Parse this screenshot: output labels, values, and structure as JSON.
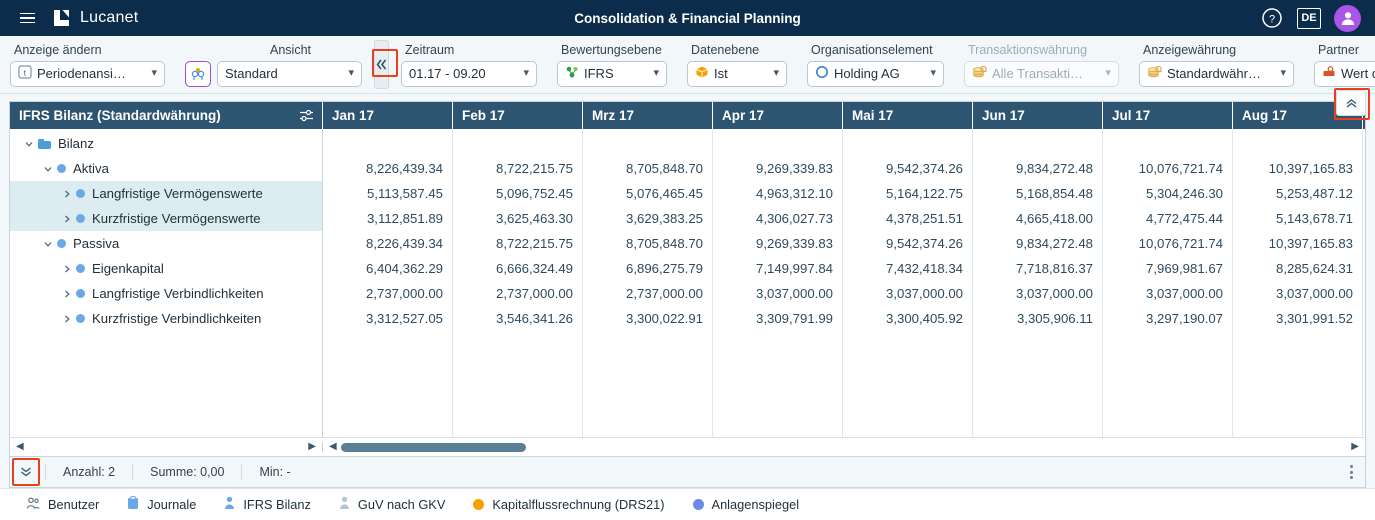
{
  "topbar": {
    "brand": "Lucanet",
    "title": "Consolidation & Financial Planning",
    "menu_icon": "hamburger-icon",
    "help_label": "?",
    "language": "DE",
    "avatar_icon": "user-avatar-icon"
  },
  "toolbar": {
    "groups": [
      {
        "label": "Anzeige ändern",
        "value": "Periodenansi…",
        "icon": "period-view-icon",
        "disabled": false
      },
      {
        "label": "Ansicht",
        "value": "Standard",
        "icon": "view-settings-icon",
        "disabled": false
      },
      {
        "label": "Zeitraum",
        "value": "01.17 - 09.20",
        "icon": "",
        "disabled": false
      },
      {
        "label": "Bewertungsebene",
        "value": "IFRS",
        "icon": "valuation-level-icon",
        "disabled": false
      },
      {
        "label": "Datenebene",
        "value": "Ist",
        "icon": "data-level-icon",
        "disabled": false
      },
      {
        "label": "Organisationselement",
        "value": "Holding AG",
        "icon": "org-element-icon",
        "disabled": false
      },
      {
        "label": "Transaktionswährung",
        "value": "Alle Transakti…",
        "icon": "currency-icon",
        "disabled": true
      },
      {
        "label": "Anzeigewährung",
        "value": "Standardwähr…",
        "icon": "currency-icon",
        "disabled": false
      },
      {
        "label": "Partner",
        "value": "Wert des Kont…",
        "icon": "partner-icon",
        "disabled": false
      }
    ],
    "collapse_left_icon": "chevron-double-left-icon"
  },
  "grid": {
    "tree_header": "IFRS Bilanz (Standardwährung)",
    "tree_header_icon": "settings-sliders-icon",
    "columns": [
      "Jan 17",
      "Feb 17",
      "Mrz 17",
      "Apr 17",
      "Mai 17",
      "Jun 17",
      "Jul 17",
      "Aug 17"
    ],
    "rows": [
      {
        "label": "Bilanz",
        "indent": 0,
        "node": "folder",
        "twisty": "down",
        "selected": false,
        "values": [
          "",
          "",
          "",
          "",
          "",
          "",
          "",
          ""
        ]
      },
      {
        "label": "Aktiva",
        "indent": 1,
        "node": "dot",
        "twisty": "down",
        "selected": false,
        "values": [
          "8,226,439.34",
          "8,722,215.75",
          "8,705,848.70",
          "9,269,339.83",
          "9,542,374.26",
          "9,834,272.48",
          "10,076,721.74",
          "10,397,165.83"
        ]
      },
      {
        "label": "Langfristige Vermögenswerte",
        "indent": 2,
        "node": "dot",
        "twisty": "right",
        "selected": true,
        "values": [
          "5,113,587.45",
          "5,096,752.45",
          "5,076,465.45",
          "4,963,312.10",
          "5,164,122.75",
          "5,168,854.48",
          "5,304,246.30",
          "5,253,487.12"
        ]
      },
      {
        "label": "Kurzfristige Vermögenswerte",
        "indent": 2,
        "node": "dot",
        "twisty": "right",
        "selected": true,
        "values": [
          "3,112,851.89",
          "3,625,463.30",
          "3,629,383.25",
          "4,306,027.73",
          "4,378,251.51",
          "4,665,418.00",
          "4,772,475.44",
          "5,143,678.71"
        ]
      },
      {
        "label": "Passiva",
        "indent": 1,
        "node": "dot",
        "twisty": "down",
        "selected": false,
        "values": [
          "8,226,439.34",
          "8,722,215.75",
          "8,705,848.70",
          "9,269,339.83",
          "9,542,374.26",
          "9,834,272.48",
          "10,076,721.74",
          "10,397,165.83"
        ]
      },
      {
        "label": "Eigenkapital",
        "indent": 2,
        "node": "dot",
        "twisty": "right",
        "selected": false,
        "values": [
          "6,404,362.29",
          "6,666,324.49",
          "6,896,275.79",
          "7,149,997.84",
          "7,432,418.34",
          "7,718,816.37",
          "7,969,981.67",
          "8,285,624.31"
        ]
      },
      {
        "label": "Langfristige Verbindlichkeiten",
        "indent": 2,
        "node": "dot",
        "twisty": "right",
        "selected": false,
        "values": [
          "2,737,000.00",
          "2,737,000.00",
          "2,737,000.00",
          "3,037,000.00",
          "3,037,000.00",
          "3,037,000.00",
          "3,037,000.00",
          "3,037,000.00"
        ]
      },
      {
        "label": "Kurzfristige Verbindlichkeiten",
        "indent": 2,
        "node": "dot",
        "twisty": "right",
        "selected": false,
        "values": [
          "3,312,527.05",
          "3,546,341.26",
          "3,300,022.91",
          "3,309,791.99",
          "3,300,405.92",
          "3,305,906.11",
          "3,297,190.07",
          "3,301,991.52"
        ]
      }
    ],
    "collapse_top_right_icon": "chevron-double-up-icon"
  },
  "statusbar": {
    "collapse_icon": "chevron-double-down-icon",
    "count": "Anzahl: 2",
    "sum": "Summe: 0,00",
    "min": "Min: -",
    "menu_icon": "kebab-menu-icon"
  },
  "footer": {
    "tabs": [
      {
        "label": "Benutzer",
        "icon": "users-icon",
        "color": "#5e7180"
      },
      {
        "label": "Journale",
        "icon": "journal-icon",
        "color": "#6aa8e8"
      },
      {
        "label": "IFRS Bilanz",
        "icon": "person-icon",
        "color": "#6aa8e8"
      },
      {
        "label": "GuV nach GKV",
        "icon": "person-icon",
        "color": "#b9c4cc"
      },
      {
        "label": "Kapitalflussrechnung (DRS21)",
        "icon": "dot-icon",
        "color": "#f5a200"
      },
      {
        "label": "Anlagenspiegel",
        "icon": "dot-icon",
        "color": "#6a8ae8"
      }
    ]
  },
  "colors": {
    "topbar_bg": "#0b2c4a",
    "grid_header_bg": "#2d5571",
    "accent_highlight": "#e8401f",
    "selection_bg": "#dcecf1",
    "avatar": "#a855e8"
  }
}
